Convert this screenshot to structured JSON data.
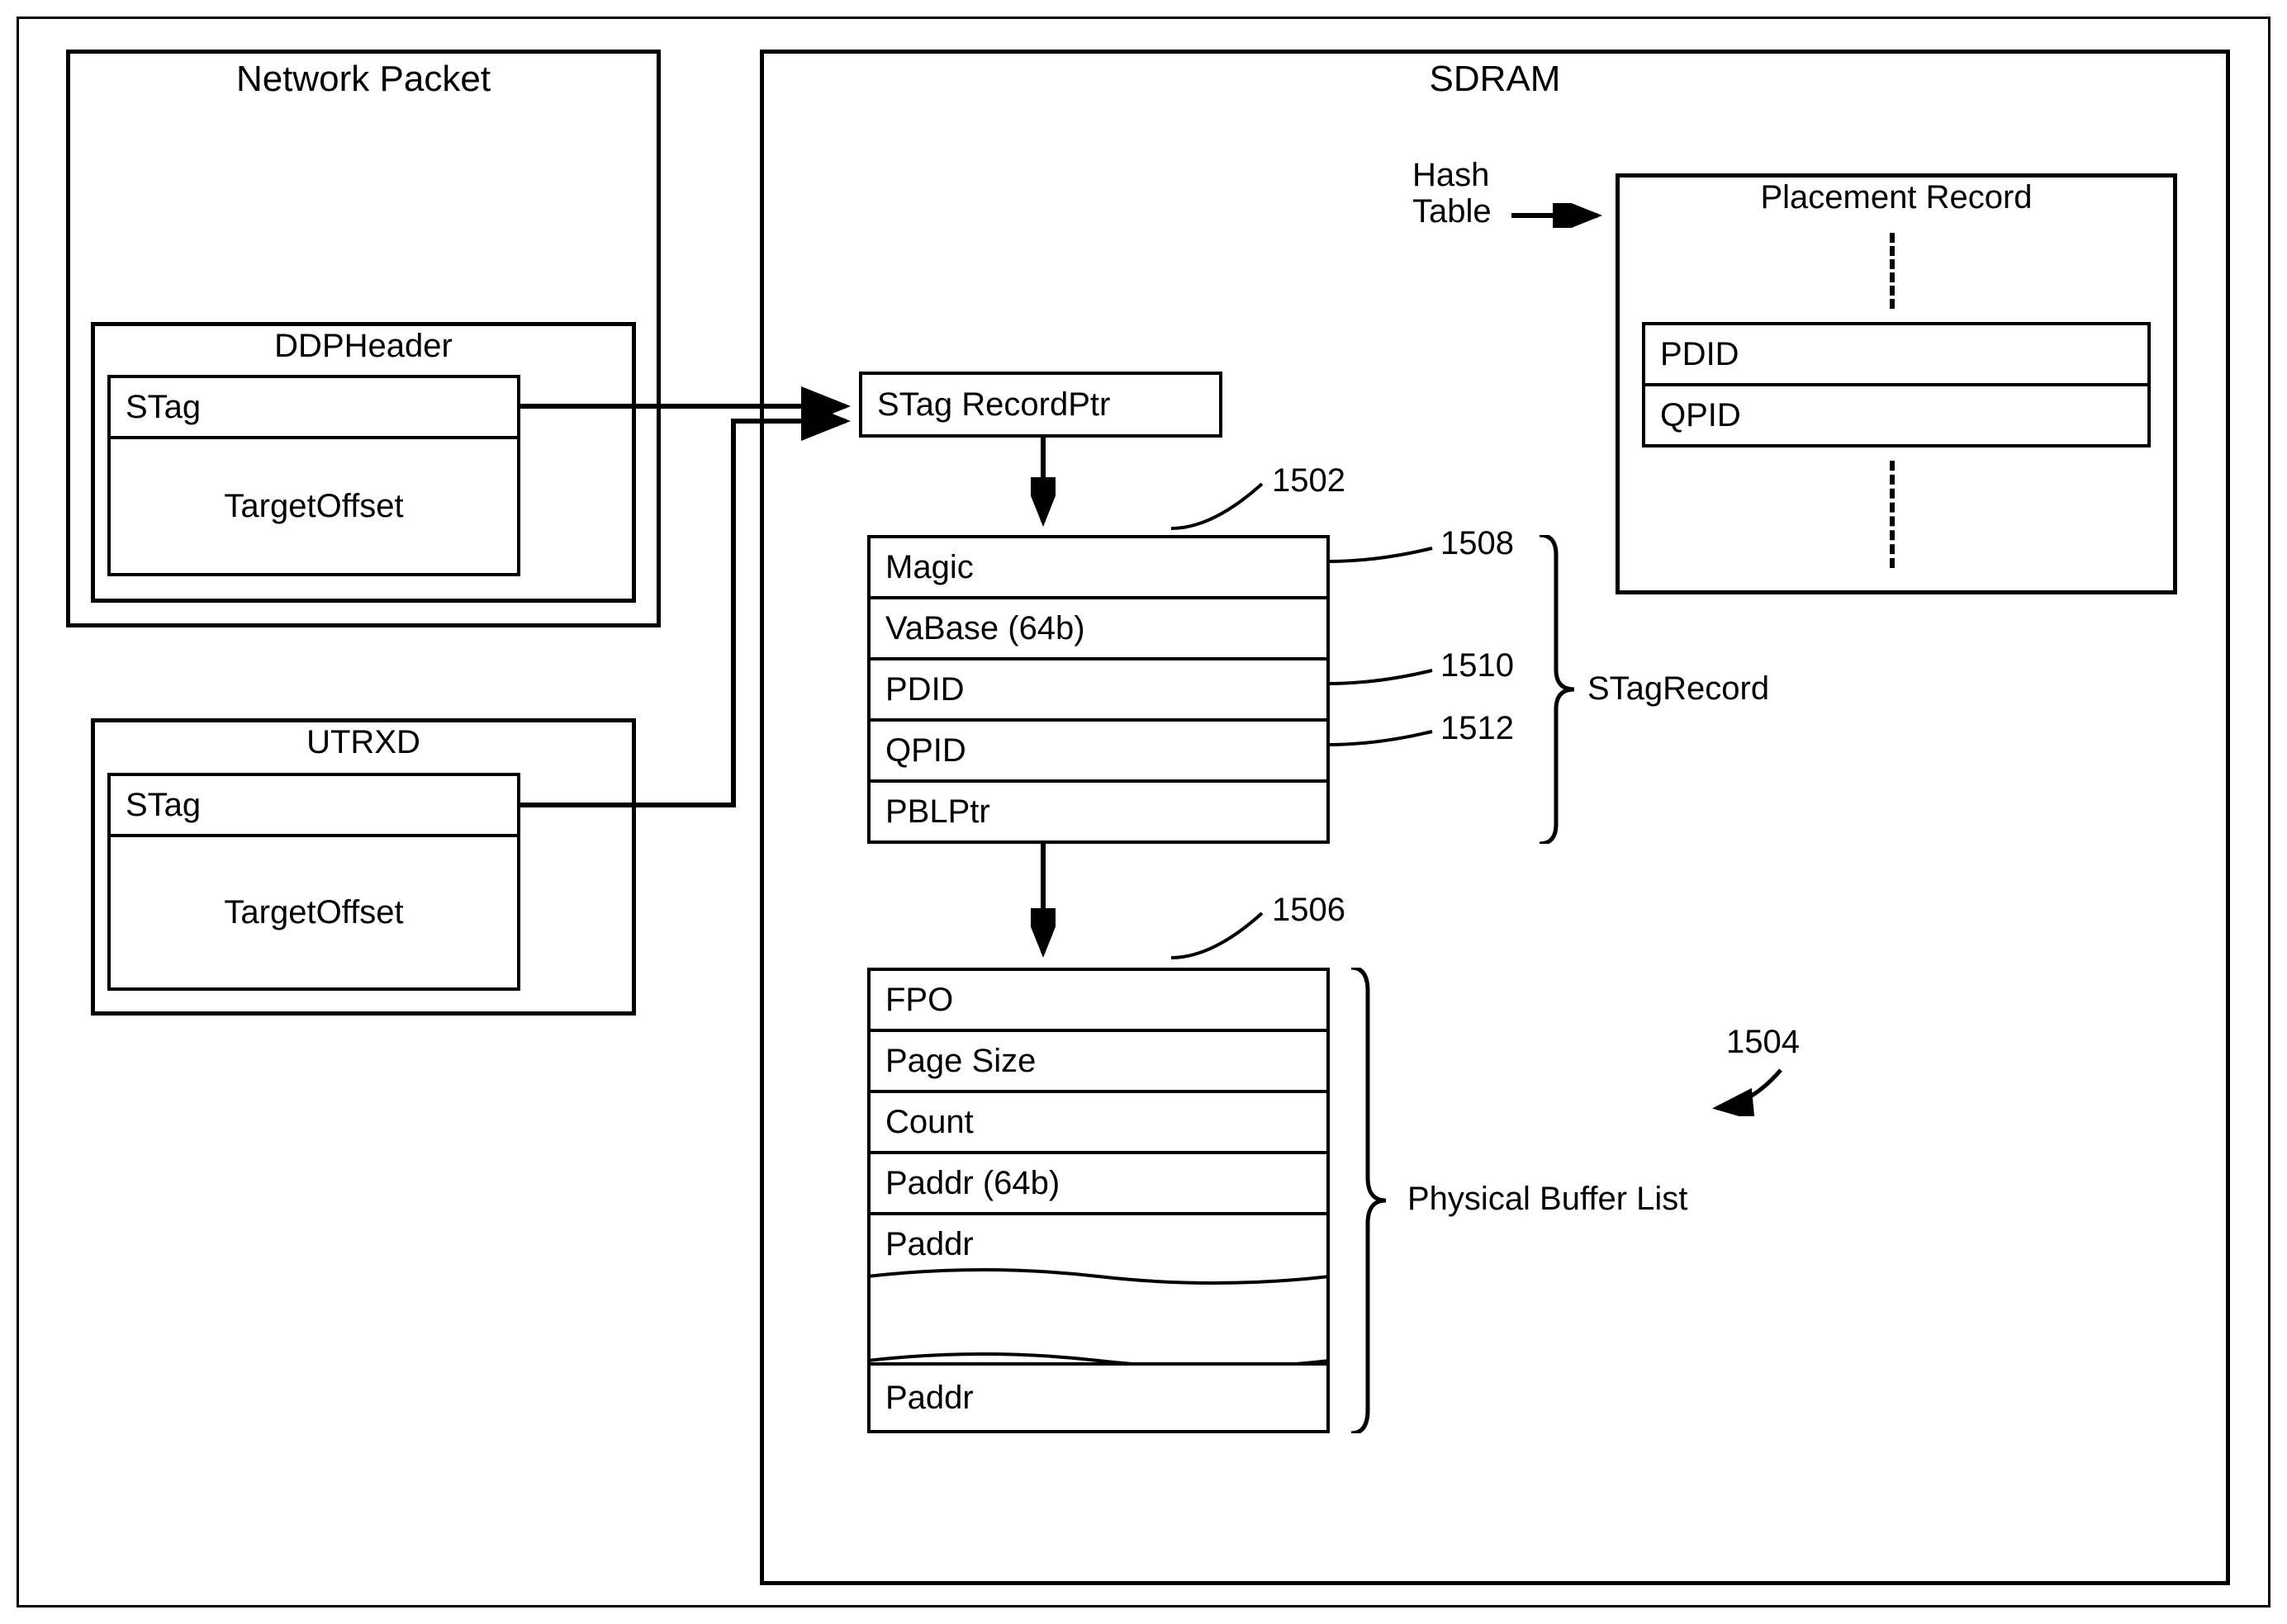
{
  "networkPacket": {
    "title": "Network Packet",
    "ddpHeader": {
      "title": "DDPHeader",
      "stag": "STag",
      "targetOffset": "TargetOffset"
    }
  },
  "utrxd": {
    "title": "UTRXD",
    "stag": "STag",
    "targetOffset": "TargetOffset"
  },
  "sdram": {
    "title": "SDRAM",
    "stagRecordPtr": "STag RecordPtr",
    "hashTableLabel": "Hash\nTable",
    "placementRecord": {
      "title": "Placement Record",
      "pdid": "PDID",
      "qpid": "QPID"
    },
    "stagRecord": {
      "magic": "Magic",
      "vabase": "VaBase (64b)",
      "pdid": "PDID",
      "qpid": "QPID",
      "pblptr": "PBLPtr",
      "label": "STagRecord"
    },
    "physicalBufferList": {
      "fpo": "FPO",
      "pageSize": "Page Size",
      "count": "Count",
      "paddr64": "Paddr (64b)",
      "paddr1": "Paddr",
      "paddr2": "Paddr",
      "label": "Physical Buffer List"
    }
  },
  "refs": {
    "r1502": "1502",
    "r1508": "1508",
    "r1510": "1510",
    "r1512": "1512",
    "r1506": "1506",
    "r1504": "1504"
  }
}
